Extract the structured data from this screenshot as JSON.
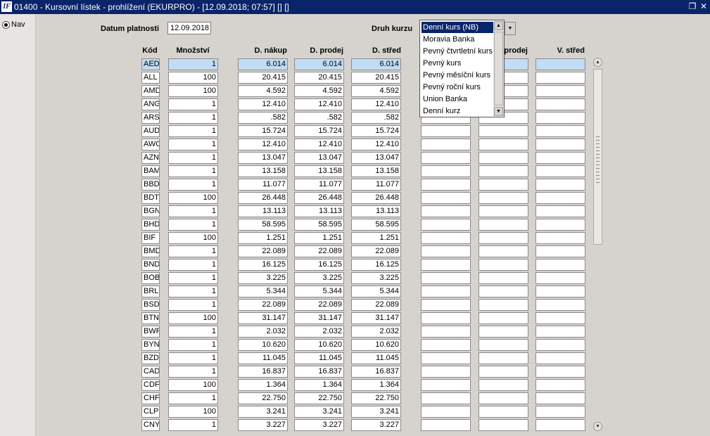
{
  "window": {
    "icon_text": "IF",
    "title": "01400 - Kursovní lístek - prohlížení (EKURPRO) - [12.09.2018; 07:57]  []  []",
    "restore_icon": "restore-icon",
    "close_icon": "close-icon"
  },
  "nav": {
    "label": "Nav",
    "selected": true
  },
  "form": {
    "datum_label": "Datum platnosti",
    "datum_value": "12.09.2018",
    "druh_label": "Druh kurzu"
  },
  "columns": {
    "kod": "Kód",
    "mnozstvi": "Množství",
    "d_nakup": "D. nákup",
    "d_prodej": "D. prodej",
    "d_stred": "D. střed",
    "v_prodej": "V. prodej",
    "v_stred": "V. střed"
  },
  "dropdown": {
    "options": [
      "Denní kurs (NB)",
      "Moravia Banka",
      "Pevný čtvrtletní kurs",
      "Pevný kurs",
      "Pevný měsíční kurs",
      "Pevný roční kurs",
      "Union Banka",
      "Denní kurz"
    ],
    "selected_index": 0
  },
  "rows": [
    {
      "kod": "AED",
      "mnozstvi": "1",
      "d_nakup": "6.014",
      "d_prodej": "6.014",
      "d_stred": "6.014"
    },
    {
      "kod": "ALL",
      "mnozstvi": "100",
      "d_nakup": "20.415",
      "d_prodej": "20.415",
      "d_stred": "20.415"
    },
    {
      "kod": "AMD",
      "mnozstvi": "100",
      "d_nakup": "4.592",
      "d_prodej": "4.592",
      "d_stred": "4.592"
    },
    {
      "kod": "ANG",
      "mnozstvi": "1",
      "d_nakup": "12.410",
      "d_prodej": "12.410",
      "d_stred": "12.410"
    },
    {
      "kod": "ARS",
      "mnozstvi": "1",
      "d_nakup": ".582",
      "d_prodej": ".582",
      "d_stred": ".582"
    },
    {
      "kod": "AUD",
      "mnozstvi": "1",
      "d_nakup": "15.724",
      "d_prodej": "15.724",
      "d_stred": "15.724"
    },
    {
      "kod": "AWG",
      "mnozstvi": "1",
      "d_nakup": "12.410",
      "d_prodej": "12.410",
      "d_stred": "12.410"
    },
    {
      "kod": "AZN",
      "mnozstvi": "1",
      "d_nakup": "13.047",
      "d_prodej": "13.047",
      "d_stred": "13.047"
    },
    {
      "kod": "BAM",
      "mnozstvi": "1",
      "d_nakup": "13.158",
      "d_prodej": "13.158",
      "d_stred": "13.158"
    },
    {
      "kod": "BBD",
      "mnozstvi": "1",
      "d_nakup": "11.077",
      "d_prodej": "11.077",
      "d_stred": "11.077"
    },
    {
      "kod": "BDT",
      "mnozstvi": "100",
      "d_nakup": "26.448",
      "d_prodej": "26.448",
      "d_stred": "26.448"
    },
    {
      "kod": "BGN",
      "mnozstvi": "1",
      "d_nakup": "13.113",
      "d_prodej": "13.113",
      "d_stred": "13.113"
    },
    {
      "kod": "BHD",
      "mnozstvi": "1",
      "d_nakup": "58.595",
      "d_prodej": "58.595",
      "d_stred": "58.595"
    },
    {
      "kod": "BIF",
      "mnozstvi": "100",
      "d_nakup": "1.251",
      "d_prodej": "1.251",
      "d_stred": "1.251"
    },
    {
      "kod": "BMD",
      "mnozstvi": "1",
      "d_nakup": "22.089",
      "d_prodej": "22.089",
      "d_stred": "22.089"
    },
    {
      "kod": "BND",
      "mnozstvi": "1",
      "d_nakup": "16.125",
      "d_prodej": "16.125",
      "d_stred": "16.125"
    },
    {
      "kod": "BOB",
      "mnozstvi": "1",
      "d_nakup": "3.225",
      "d_prodej": "3.225",
      "d_stred": "3.225"
    },
    {
      "kod": "BRL",
      "mnozstvi": "1",
      "d_nakup": "5.344",
      "d_prodej": "5.344",
      "d_stred": "5.344"
    },
    {
      "kod": "BSD",
      "mnozstvi": "1",
      "d_nakup": "22.089",
      "d_prodej": "22.089",
      "d_stred": "22.089"
    },
    {
      "kod": "BTN",
      "mnozstvi": "100",
      "d_nakup": "31.147",
      "d_prodej": "31.147",
      "d_stred": "31.147"
    },
    {
      "kod": "BWP",
      "mnozstvi": "1",
      "d_nakup": "2.032",
      "d_prodej": "2.032",
      "d_stred": "2.032"
    },
    {
      "kod": "BYN",
      "mnozstvi": "1",
      "d_nakup": "10.620",
      "d_prodej": "10.620",
      "d_stred": "10.620"
    },
    {
      "kod": "BZD",
      "mnozstvi": "1",
      "d_nakup": "11.045",
      "d_prodej": "11.045",
      "d_stred": "11.045"
    },
    {
      "kod": "CAD",
      "mnozstvi": "1",
      "d_nakup": "16.837",
      "d_prodej": "16.837",
      "d_stred": "16.837"
    },
    {
      "kod": "CDF",
      "mnozstvi": "100",
      "d_nakup": "1.364",
      "d_prodej": "1.364",
      "d_stred": "1.364"
    },
    {
      "kod": "CHF",
      "mnozstvi": "1",
      "d_nakup": "22.750",
      "d_prodej": "22.750",
      "d_stred": "22.750"
    },
    {
      "kod": "CLP",
      "mnozstvi": "100",
      "d_nakup": "3.241",
      "d_prodej": "3.241",
      "d_stred": "3.241"
    },
    {
      "kod": "CNY",
      "mnozstvi": "1",
      "d_nakup": "3.227",
      "d_prodej": "3.227",
      "d_stred": "3.227"
    }
  ],
  "scrollbar": {
    "up_icon": "scroll-up-icon",
    "down_icon": "scroll-down-icon"
  }
}
